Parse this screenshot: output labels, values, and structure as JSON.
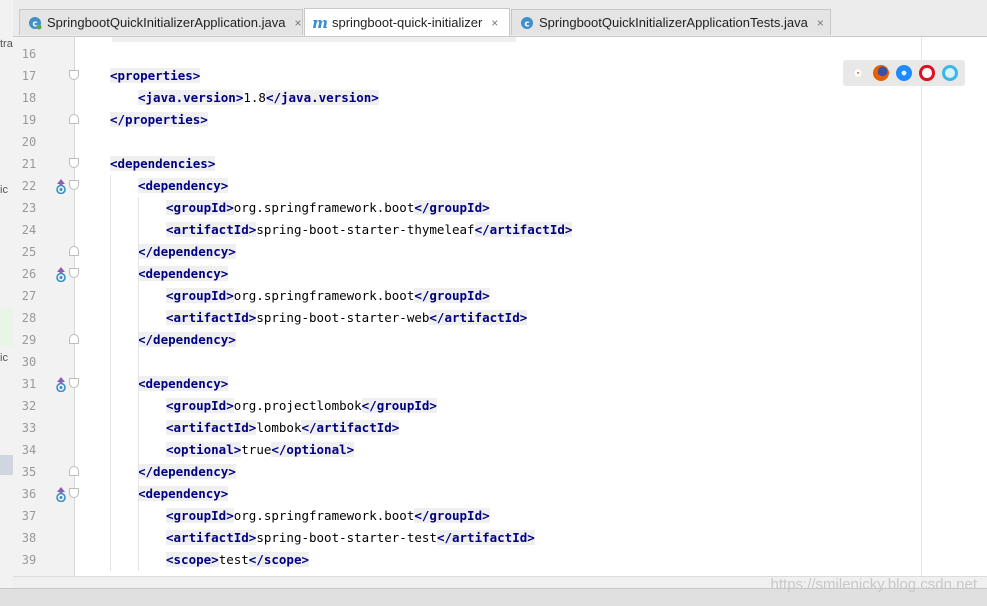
{
  "tabs": [
    {
      "label": "SpringbootQuickInitializerApplication.java",
      "icon": "java-class-icon",
      "active": false
    },
    {
      "label": "springboot-quick-initializer",
      "icon": "maven-icon",
      "active": true
    },
    {
      "label": "SpringbootQuickInitializerApplicationTests.java",
      "icon": "java-class-icon",
      "active": false
    }
  ],
  "tab_close_glyph": "×",
  "maven_glyph": "m",
  "left_panel_fragments": [
    "tra",
    "ic",
    "ic"
  ],
  "lines": [
    {
      "num": "16",
      "text": ""
    },
    {
      "num": "17",
      "text": "<properties>"
    },
    {
      "num": "18",
      "text": "<java.version>1.8</java.version>"
    },
    {
      "num": "19",
      "text": "</properties>"
    },
    {
      "num": "20",
      "text": ""
    },
    {
      "num": "21",
      "text": "<dependencies>"
    },
    {
      "num": "22",
      "text": "<dependency>"
    },
    {
      "num": "23",
      "text": "<groupId>org.springframework.boot</groupId>"
    },
    {
      "num": "24",
      "text": "<artifactId>spring-boot-starter-thymeleaf</artifactId>"
    },
    {
      "num": "25",
      "text": "</dependency>"
    },
    {
      "num": "26",
      "text": "<dependency>"
    },
    {
      "num": "27",
      "text": "<groupId>org.springframework.boot</groupId>"
    },
    {
      "num": "28",
      "text": "<artifactId>spring-boot-starter-web</artifactId>"
    },
    {
      "num": "29",
      "text": "</dependency>"
    },
    {
      "num": "30",
      "text": ""
    },
    {
      "num": "31",
      "text": "<dependency>"
    },
    {
      "num": "32",
      "text": "<groupId>org.projectlombok</groupId>"
    },
    {
      "num": "33",
      "text": "<artifactId>lombok</artifactId>"
    },
    {
      "num": "34",
      "text": "<optional>true</optional>"
    },
    {
      "num": "35",
      "text": "</dependency>"
    },
    {
      "num": "36",
      "text": "<dependency>"
    },
    {
      "num": "37",
      "text": "<groupId>org.springframework.boot</groupId>"
    },
    {
      "num": "38",
      "text": "<artifactId>spring-boot-starter-test</artifactId>"
    },
    {
      "num": "39",
      "text": "<scope>test</scope>"
    }
  ],
  "browser_icons": [
    "chrome-icon",
    "firefox-icon",
    "safari-icon",
    "opera-icon",
    "ie-icon"
  ],
  "watermark": "https://smilenicky.blog.csdn.net",
  "colors": {
    "tag": "#000080",
    "tag_bg": "#efefef",
    "line_number": "#999999",
    "gutter_bg": "#f2f2f2",
    "maven_icon": "#3d8bd0",
    "override_marker": "#8e5fb5"
  }
}
